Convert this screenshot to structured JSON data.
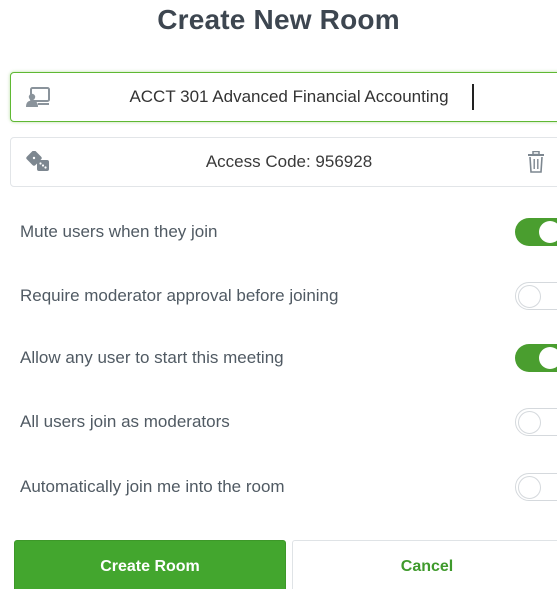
{
  "dialog": {
    "title": "Create New Room"
  },
  "room_name": {
    "value": "ACCT 301 Advanced Financial Accounting",
    "icon": "room-presentation-icon"
  },
  "access_code": {
    "text": "Access Code: 956928",
    "icon": "dice-icon",
    "delete_icon": "trash-icon"
  },
  "options": [
    {
      "label": "Mute users when they join",
      "enabled": true
    },
    {
      "label": "Require moderator approval before joining",
      "enabled": false
    },
    {
      "label": "Allow any user to start this meeting",
      "enabled": true
    },
    {
      "label": "All users join as moderators",
      "enabled": false
    },
    {
      "label": "Automatically join me into the room",
      "enabled": false
    }
  ],
  "buttons": {
    "create_label": "Create Room",
    "cancel_label": "Cancel"
  },
  "colors": {
    "accent": "#43a62e",
    "toggle_on": "#4a9e2f",
    "focus_border": "#5fb833"
  }
}
